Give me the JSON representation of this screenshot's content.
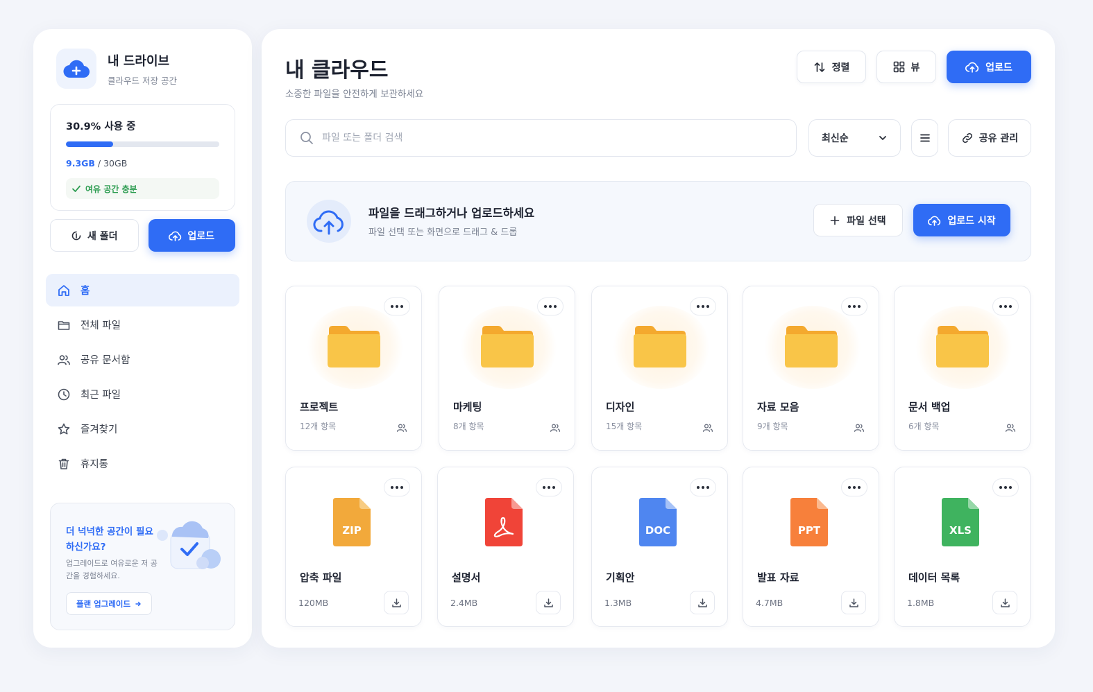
{
  "brand": {
    "title": "내 드라이브",
    "subtitle": "클라우드 저장 공간"
  },
  "storage": {
    "usage_label": "30.9% 사용 중",
    "usage_fraction": 0.309,
    "used": "9.3GB",
    "total": " / 30GB",
    "status": "여유 공간 충분",
    "status_color": "#2e9d52"
  },
  "sidebar": {
    "new_folder_label": "새 폴더",
    "upload_label": "업로드",
    "nav": [
      {
        "label": "홈",
        "icon": "home-icon",
        "active": true
      },
      {
        "label": "전체 파일",
        "icon": "folder-icon"
      },
      {
        "label": "공유 문서함",
        "icon": "users-icon"
      },
      {
        "label": "최근 파일",
        "icon": "clock-icon"
      },
      {
        "label": "즐겨찾기",
        "icon": "star-icon"
      },
      {
        "label": "휴지통",
        "icon": "trash-icon"
      }
    ],
    "promo": {
      "title": "더 넉넉한 공간이 필요하신가요?",
      "description": "업그레이드로 여유로운 저 공간을 경험하세요.",
      "button_label": "플랜 업그레이드"
    }
  },
  "header": {
    "title": "내 클라우드",
    "subtitle": "소중한 파일을 안전하게 보관하세요",
    "sort_label": "정렬",
    "view_label": "뷰",
    "upload_label": "업로드"
  },
  "toolbar": {
    "search_placeholder": "파일 또는 폴더 검색",
    "sort_option": "최신순",
    "share_label": "공유 관리"
  },
  "dropzone": {
    "title": "파일을 드래그하거나 업로드하세요",
    "subtitle": "파일 선택 또는 화면으로 드래그 & 드롭",
    "select_label": "파일 선택",
    "start_label": "업로드 시작"
  },
  "folders": [
    {
      "name": "프로젝트",
      "meta": "12개 항목"
    },
    {
      "name": "마케팅",
      "meta": "8개 항목"
    },
    {
      "name": "디자인",
      "meta": "15개 항목"
    },
    {
      "name": "자료 모음",
      "meta": "9개 항목"
    },
    {
      "name": "문서 백업",
      "meta": "6개 항목"
    }
  ],
  "files": [
    {
      "name": "압축 파일",
      "size": "120MB",
      "type": "ZIP",
      "color": "#f2a93b"
    },
    {
      "name": "설명서",
      "size": "2.4MB",
      "type": "PDF",
      "color": "#f04438"
    },
    {
      "name": "기획안",
      "size": "1.3MB",
      "type": "DOC",
      "color": "#4f86f0"
    },
    {
      "name": "발표 자료",
      "size": "4.7MB",
      "type": "PPT",
      "color": "#f7803b"
    },
    {
      "name": "데이터 목록",
      "size": "1.8MB",
      "type": "XLS",
      "color": "#3fb35f"
    }
  ],
  "colors": {
    "accent": "#2f6cf5",
    "folder": "#f7bb3a"
  }
}
